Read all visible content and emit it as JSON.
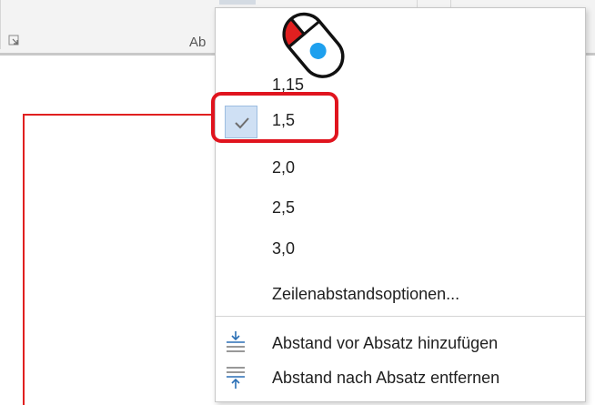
{
  "ribbon": {
    "group_label": "Ab"
  },
  "menu": {
    "items": [
      {
        "label": "1,15",
        "checked": false
      },
      {
        "label": "1,5",
        "checked": true
      },
      {
        "label": "2,0",
        "checked": false
      },
      {
        "label": "2,5",
        "checked": false
      },
      {
        "label": "3,0",
        "checked": false
      },
      {
        "label": "Zeilenabstandsoptionen...",
        "checked": false
      }
    ],
    "space_before": "Abstand vor Absatz hinzufügen",
    "space_after": "Abstand nach Absatz entfernen"
  },
  "colors": {
    "highlight": "#e0141e",
    "check_bg": "#cfe0f4",
    "icon_blue": "#2a6fb5",
    "mouse_button": "#e02020",
    "mouse_dot": "#1ea0ee"
  },
  "icons": [
    "dialog-launcher-icon",
    "checkmark-icon",
    "add-space-before-icon",
    "remove-space-after-icon",
    "mouse-click-icon"
  ]
}
